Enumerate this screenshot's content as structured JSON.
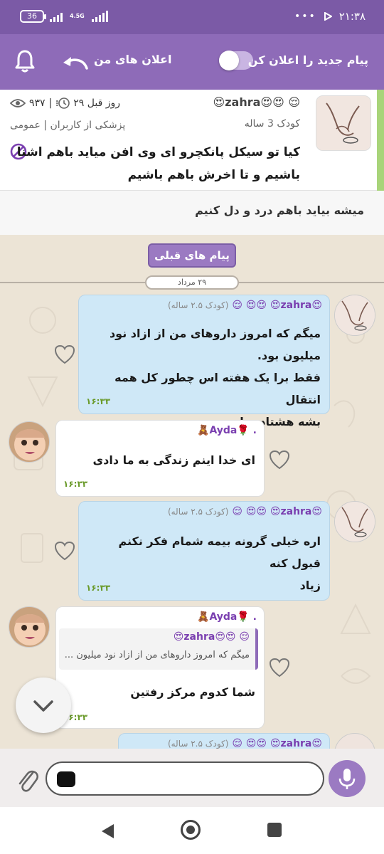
{
  "status_bar": {
    "battery": "36",
    "network": "4.5G",
    "time": "۲۱:۳۸",
    "dots": "•••"
  },
  "app_bar": {
    "announce_label": "اعلان های من",
    "new_message_label": "پیام جدید را اعلان کن",
    "toggle_on": false
  },
  "post": {
    "username": "😌 😍😍zahra😍",
    "age_label": "کودک 3 ساله",
    "category": "پزشکی از کاربران | عمومی",
    "time_ago": "۲۹ روز قبل",
    "views": "۹۳۷",
    "title": "کیا تو سیکل پانکچرو ای وی افن میاید باهم اشنا باشیم و تا اخرش باهم باشیم",
    "body": "میشه بیاید باهم درد و دل کنیم"
  },
  "chat": {
    "previous_button": "پیام های قبلی",
    "date": "۲۹ مرداد",
    "messages": [
      {
        "sender": "😍zahra😍 😍😍 😌",
        "sub": "(کودک ۲.۵ ساله)",
        "lines": [
          "میگم که امروز داروهای من از ازاد نود میلیون بود.",
          "فقط برا یک هفته اس چطور کل همه  انتقال",
          "بشه هشتاد میلیون"
        ],
        "time": "۱۶:۳۳"
      },
      {
        "sender": ". 🌹Ayda🧸",
        "lines": [
          "ای خدا اینم زندگی به ما دادی"
        ],
        "time": "۱۶:۳۳"
      },
      {
        "sender": "😍zahra😍 😍😍 😌",
        "sub": "(کودک ۲.۵ ساله)",
        "lines": [
          "اره خیلی گرونه بیمه شمام فکر نکنم قبول کنه",
          "زیاد"
        ],
        "time": "۱۶:۳۳"
      },
      {
        "sender": ". 🌹Ayda🧸",
        "quote_name": "😌 😍😍zahra😍",
        "quote_text": "میگم که امروز داروهای من از ازاد نود میلیون ...",
        "lines": [
          "شما کدوم مرکز رفتین"
        ],
        "time": "۱۶:۳۳"
      },
      {
        "sender": "😍zahra😍 😍😍 😌",
        "sub": "(کودک ۲.۵ ساله)"
      }
    ]
  },
  "composer": {
    "placeholder": ""
  },
  "colors": {
    "primary": "#8e6bb8",
    "status": "#7b5aa6",
    "out_bubble": "#cfe8f7",
    "in_bubble": "#ffffff",
    "time": "#6a9a2a",
    "accent": "#a8d47a"
  },
  "icons": [
    "bell-icon",
    "back-arrow-icon",
    "eye-icon",
    "clock-icon",
    "ban-icon",
    "heart-icon",
    "chevron-down-icon",
    "paperclip-icon",
    "sticker-icon",
    "mic-icon"
  ]
}
